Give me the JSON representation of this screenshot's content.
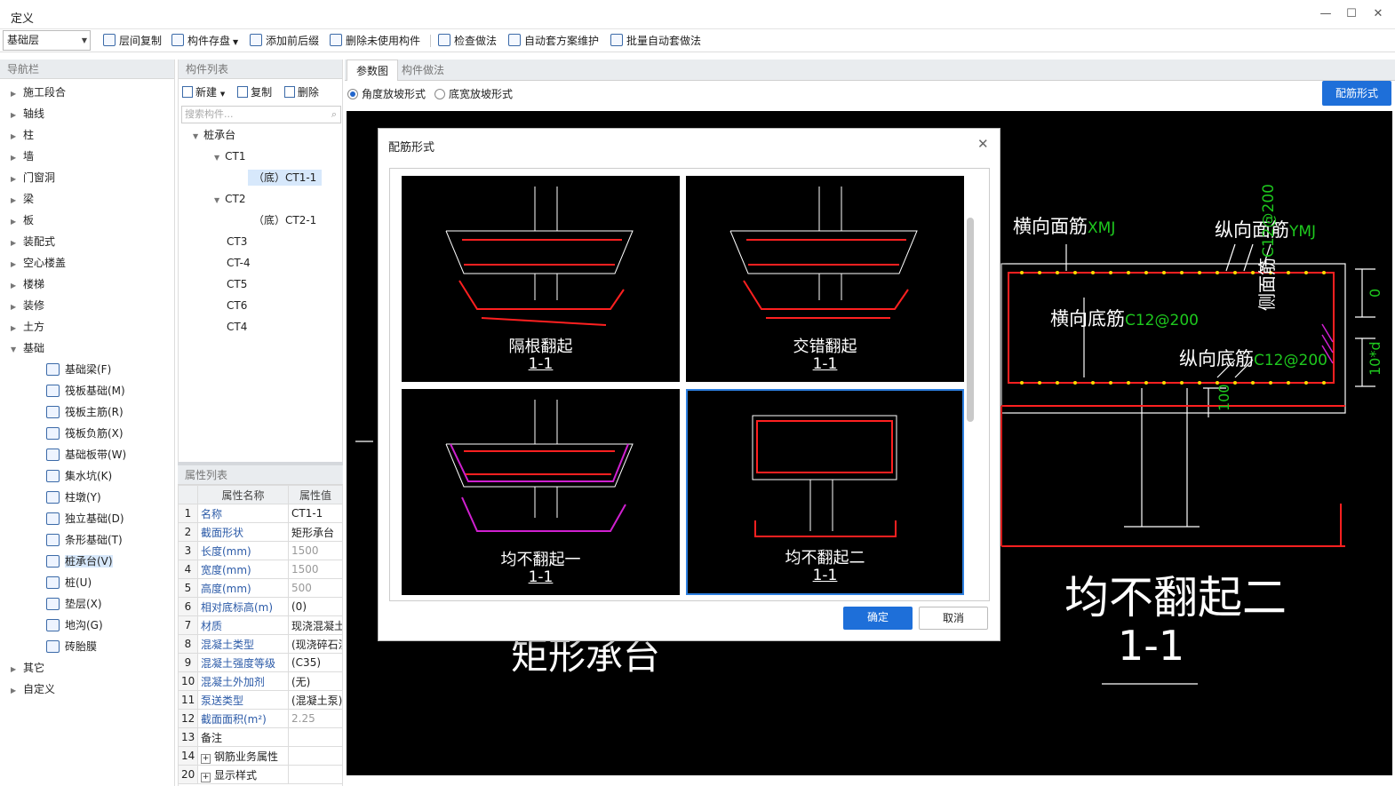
{
  "window": {
    "title": "定义"
  },
  "toolbar": {
    "floor": "基础层",
    "buttons": [
      "层间复制",
      "构件存盘",
      "添加前后缀",
      "删除未使用构件",
      "检查做法",
      "自动套方案维护",
      "批量自动套做法"
    ]
  },
  "nav": {
    "header": "导航栏",
    "items": [
      "施工段合",
      "轴线",
      "柱",
      "墙",
      "门窗洞",
      "梁",
      "板",
      "装配式",
      "空心楼盖",
      "楼梯",
      "装修",
      "土方",
      "基础"
    ],
    "sub": [
      "基础梁(F)",
      "筏板基础(M)",
      "筏板主筋(R)",
      "筏板负筋(X)",
      "基础板带(W)",
      "集水坑(K)",
      "柱墩(Y)",
      "独立基础(D)",
      "条形基础(T)",
      "桩承台(V)",
      "桩(U)",
      "垫层(X)",
      "地沟(G)",
      "砖胎膜"
    ],
    "tail": [
      "其它",
      "自定义"
    ]
  },
  "components": {
    "header": "构件列表",
    "new": "新建",
    "copy": "复制",
    "delete": "删除",
    "search_placeholder": "搜索构件...",
    "root": "桩承台",
    "nodes": [
      "CT1",
      "（底）CT1-1",
      "CT2",
      "（底）CT2-1",
      "CT3",
      "CT-4",
      "CT5",
      "CT6",
      "CT4"
    ]
  },
  "properties": {
    "header": "属性列表",
    "col_name": "属性名称",
    "col_value": "属性值",
    "rows": [
      {
        "n": "1",
        "name": "名称",
        "value": "CT1-1"
      },
      {
        "n": "2",
        "name": "截面形状",
        "value": "矩形承台"
      },
      {
        "n": "3",
        "name": "长度(mm)",
        "value": "1500"
      },
      {
        "n": "4",
        "name": "宽度(mm)",
        "value": "1500"
      },
      {
        "n": "5",
        "name": "高度(mm)",
        "value": "500"
      },
      {
        "n": "6",
        "name": "相对底标高(m)",
        "value": "(0)"
      },
      {
        "n": "7",
        "name": "材质",
        "value": "现浇混凝土"
      },
      {
        "n": "8",
        "name": "混凝土类型",
        "value": "(现浇碎石混"
      },
      {
        "n": "9",
        "name": "混凝土强度等级",
        "value": "(C35)"
      },
      {
        "n": "10",
        "name": "混凝土外加剂",
        "value": "(无)"
      },
      {
        "n": "11",
        "name": "泵送类型",
        "value": "(混凝土泵)"
      },
      {
        "n": "12",
        "name": "截面面积(m²)",
        "value": "2.25"
      },
      {
        "n": "13",
        "name": "备注",
        "value": ""
      },
      {
        "n": "14",
        "name": "钢筋业务属性",
        "value": ""
      },
      {
        "n": "20",
        "name": "显示样式",
        "value": ""
      }
    ]
  },
  "right": {
    "tabs": [
      "参数图",
      "构件做法"
    ],
    "radio1": "角度放坡形式",
    "radio2": "底宽放坡形式",
    "rebar_btn": "配筋形式"
  },
  "canvas": {
    "top_label1": "横向面筋",
    "top_code1": "XMJ",
    "top_label2": "纵向面筋",
    "top_code2": "YMJ",
    "bot_label1": "横向底筋",
    "bot_code1": "C12@200",
    "bot_label2": "纵向底筋",
    "bot_code2": "C12@200",
    "side_label": "侧面筋",
    "side_code": "C12@200",
    "dim0": "0",
    "dim10d": "10*d",
    "dim100": "100",
    "big_title": "均不翻起二",
    "big_sec": "1-1",
    "behind_text": "矩形承台"
  },
  "dialog": {
    "title": "配筋形式",
    "ok": "确定",
    "cancel": "取消",
    "options": [
      {
        "title": "隔根翻起",
        "sec": "1-1"
      },
      {
        "title": "交错翻起",
        "sec": "1-1"
      },
      {
        "title": "均不翻起一",
        "sec": "1-1"
      },
      {
        "title": "均不翻起二",
        "sec": "1-1"
      }
    ]
  },
  "colors": {
    "accent": "#1e6fd9",
    "rebar": "#ff2020",
    "label_code": "#1ec81e",
    "magenta": "#d020d0"
  }
}
